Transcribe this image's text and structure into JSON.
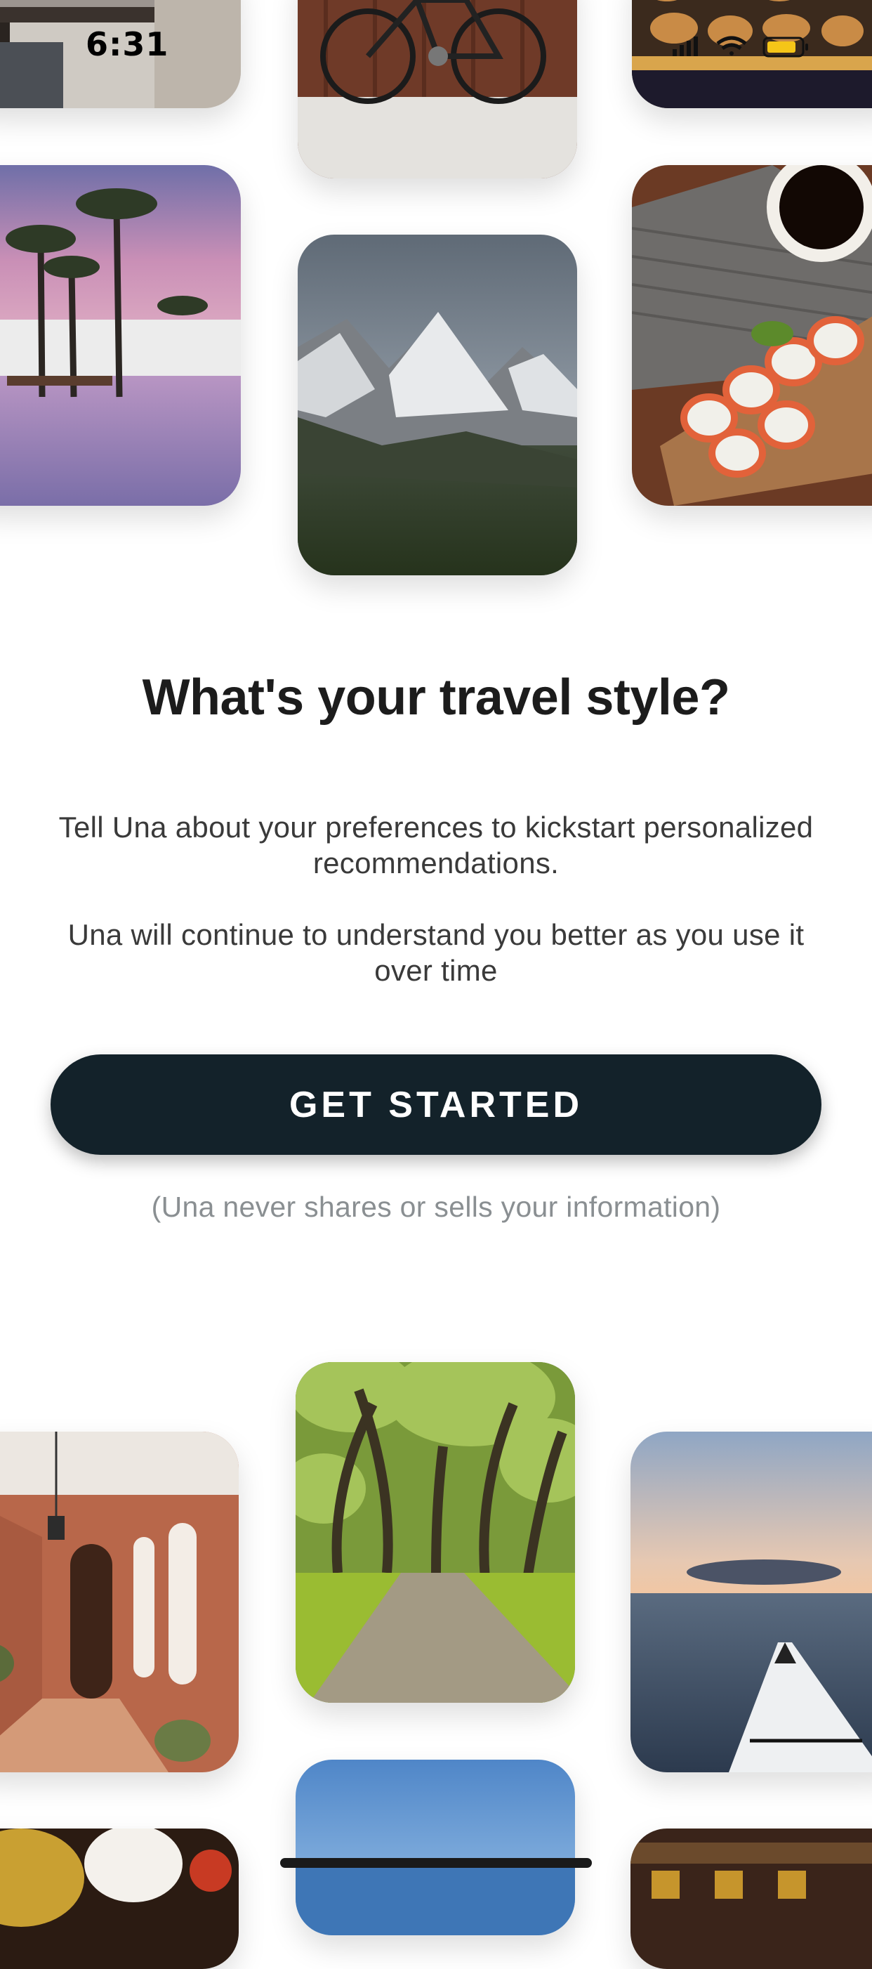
{
  "status_bar": {
    "time": "6:31"
  },
  "onboarding": {
    "title": "What's your travel style?",
    "paragraph_1": "Tell Una about your preferences to kickstart personalized recommendations.",
    "paragraph_2": "Una will continue to understand you better as you use it over time",
    "cta_label": "GET STARTED",
    "privacy_note": "(Una never shares or sells your information)"
  },
  "colors": {
    "cta_background": "#13222a",
    "cta_text": "#ffffff",
    "title_text": "#1c1c1c",
    "body_text": "#3a3a3a",
    "muted_text": "#8a8f92",
    "background": "#ffffff"
  },
  "tiles": [
    {
      "subject": "table-photo"
    },
    {
      "subject": "bicycle-photo"
    },
    {
      "subject": "pastries-photo"
    },
    {
      "subject": "palm-pool-photo"
    },
    {
      "subject": "mountain-photo"
    },
    {
      "subject": "sushi-photo"
    },
    {
      "subject": "hallway-photo"
    },
    {
      "subject": "forest-path-photo"
    },
    {
      "subject": "kayak-photo"
    },
    {
      "subject": "food-bowls-photo"
    },
    {
      "subject": "lake-photo"
    },
    {
      "subject": "market-photo"
    }
  ]
}
